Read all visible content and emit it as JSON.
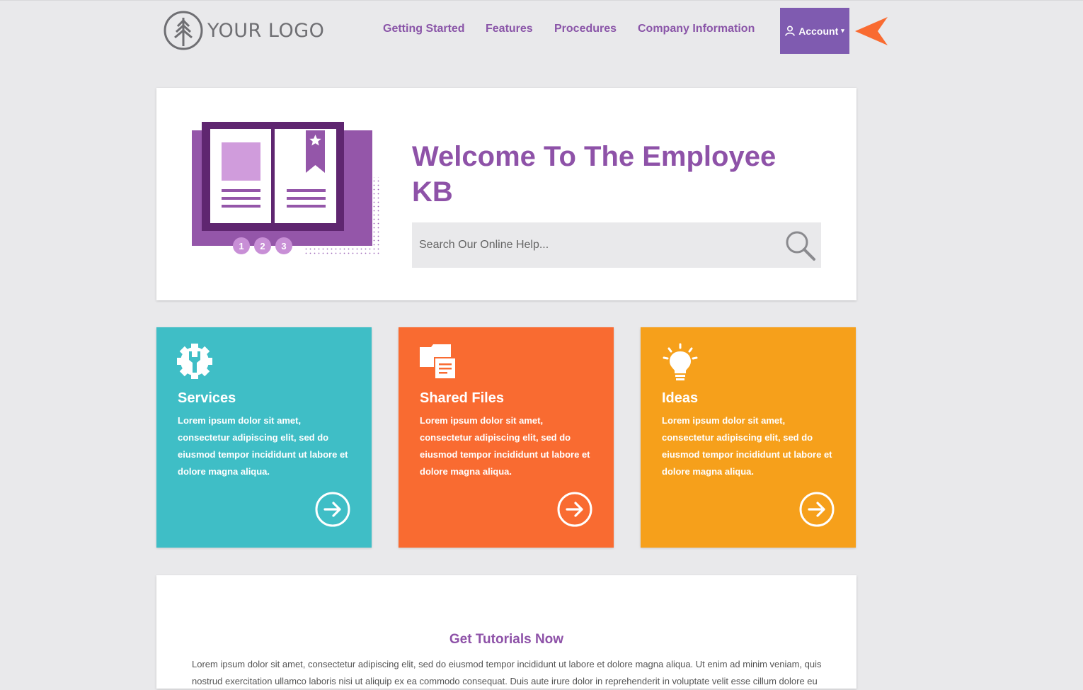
{
  "header": {
    "logo_text": "YOUR LOGO",
    "nav": [
      {
        "label": "Getting Started"
      },
      {
        "label": "Features"
      },
      {
        "label": "Procedures"
      },
      {
        "label": "Company Information"
      }
    ],
    "account_label": "Account",
    "account_caret": "▾"
  },
  "hero": {
    "title": "Welcome To The Employee KB",
    "search_placeholder": "Search Our Online Help...",
    "steps": [
      "1",
      "2",
      "3"
    ]
  },
  "cards": [
    {
      "title": "Services",
      "text": "Lorem ipsum dolor sit amet, consectetur adipiscing elit, sed do eiusmod tempor incididunt ut labore et dolore magna aliqua.",
      "color": "#3fbec6",
      "icon": "wrench-gear-icon"
    },
    {
      "title": "Shared Files",
      "text": "Lorem ipsum dolor sit amet, consectetur adipiscing elit, sed do eiusmod tempor incididunt ut labore et dolore magna aliqua.",
      "color": "#f96b31",
      "icon": "files-icon"
    },
    {
      "title": "Ideas",
      "text": "Lorem ipsum dolor sit amet, consectetur adipiscing elit, sed do eiusmod tempor incididunt ut labore et dolore magna aliqua.",
      "color": "#f6a01b",
      "icon": "lightbulb-icon"
    }
  ],
  "tutorials": {
    "title": "Get Tutorials Now",
    "text": "Lorem ipsum dolor sit amet, consectetur adipiscing elit, sed do eiusmod tempor incididunt ut labore et dolore magna aliqua. Ut enim ad minim veniam, quis nostrud exercitation ullamco laboris nisi ut aliquip ex ea commodo consequat. Duis aute irure dolor in reprehenderit in voluptate velit esse cillum dolore eu"
  },
  "colors": {
    "brand_purple": "#8e52a8",
    "account_purple": "#7f5bb0",
    "pointer_orange": "#f96b31",
    "page_bg": "#e9e9eb"
  }
}
